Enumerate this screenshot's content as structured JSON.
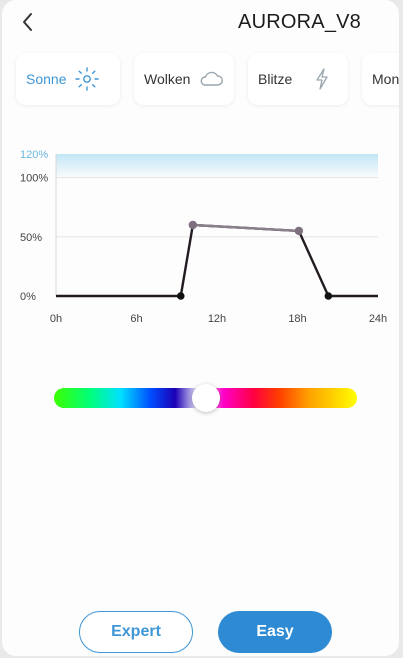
{
  "header": {
    "title": "AURORA_V8",
    "back_icon": "chevron-left-icon"
  },
  "tabs": [
    {
      "label": "Sonne",
      "icon": "sun-icon",
      "active": true
    },
    {
      "label": "Wolken",
      "icon": "cloud-icon",
      "active": false
    },
    {
      "label": "Blitze",
      "icon": "lightning-icon",
      "active": false
    },
    {
      "label": "Mon",
      "icon": "",
      "active": false
    }
  ],
  "chart_data": {
    "type": "line",
    "xlabel": "",
    "ylabel": "",
    "x_ticks": [
      "0h",
      "6h",
      "12h",
      "18h",
      "24h"
    ],
    "y_ticks": [
      "0%",
      "50%",
      "100%",
      "120%"
    ],
    "xlim": [
      0,
      24
    ],
    "ylim": [
      0,
      120
    ],
    "x": [
      0,
      9.3,
      10.2,
      18.1,
      20.3,
      24
    ],
    "y": [
      0,
      0,
      60,
      55,
      0,
      0
    ],
    "line_color": "#221b22",
    "highlight_color": "#bfe4f5"
  },
  "color_slider": {
    "value": 0.5
  },
  "buttons": {
    "expert_label": "Expert",
    "easy_label": "Easy"
  },
  "colors": {
    "accent": "#3f97d6",
    "primary_button": "#2e8bd3"
  }
}
